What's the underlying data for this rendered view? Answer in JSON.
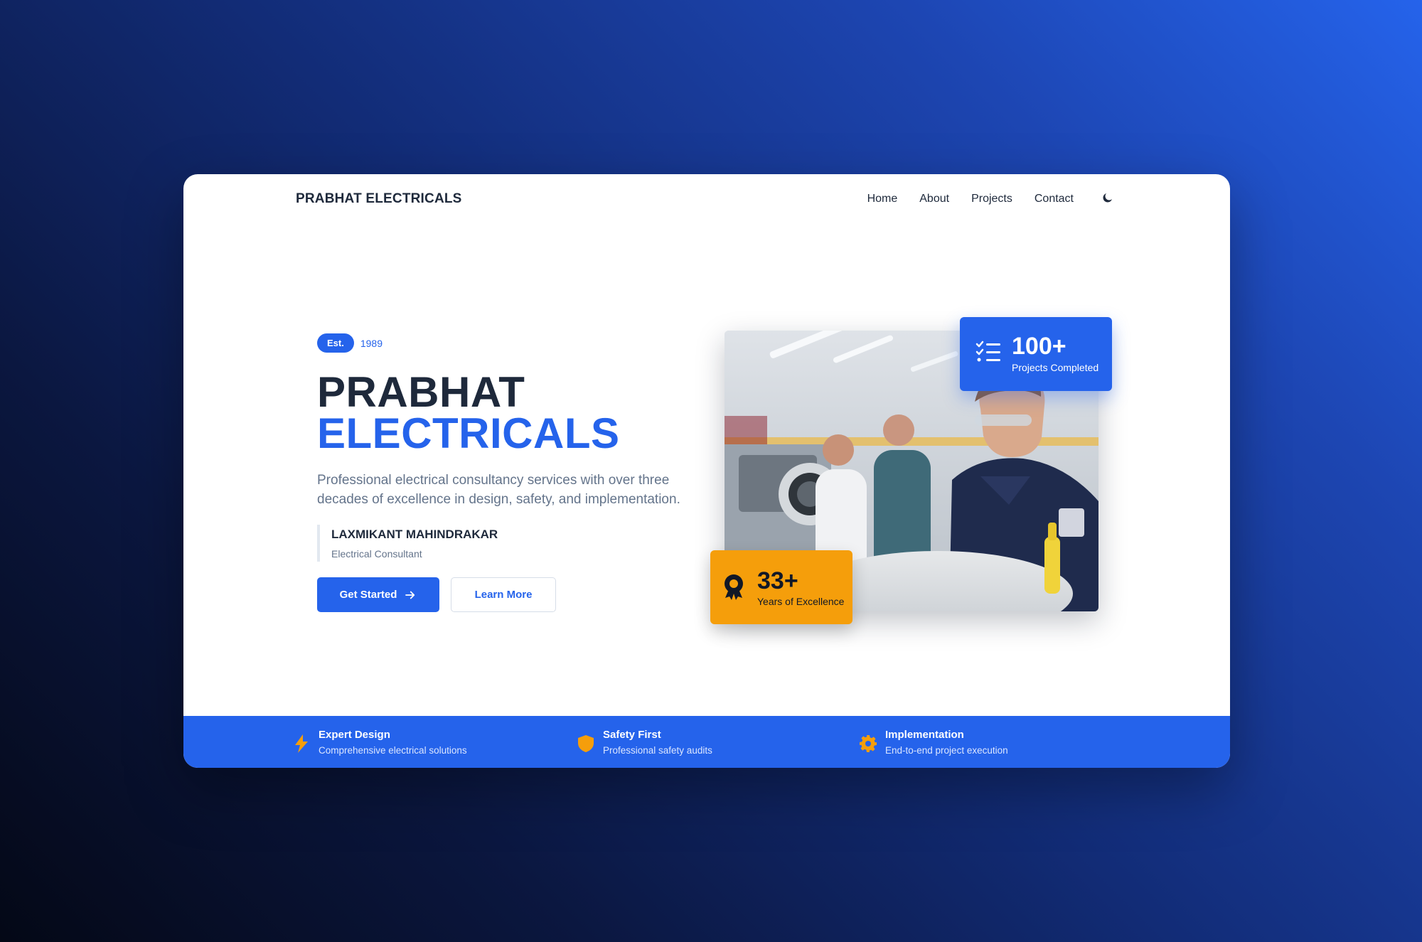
{
  "header": {
    "brand": "PRABHAT ELECTRICALS",
    "nav": [
      "Home",
      "About",
      "Projects",
      "Contact"
    ],
    "theme_icon": "moon-icon"
  },
  "hero": {
    "badge": "Est.",
    "year": "1989",
    "title_line1": "PRABHAT",
    "title_line2": "ELECTRICALS",
    "description": "Professional electrical consultancy services with over three decades of excellence in design, safety, and implementation.",
    "person_name": "LAXMIKANT MAHINDRAKAR",
    "person_role": "Electrical Consultant",
    "primary_button": "Get Started",
    "secondary_button": "Learn More",
    "image_description_icon": "engineers-workshop-photo"
  },
  "stats": {
    "projects_value": "100+",
    "projects_label": "Projects Completed",
    "projects_icon": "checklist-icon",
    "years_value": "33+",
    "years_label": "Years of Excellence",
    "years_icon": "award-icon"
  },
  "features": [
    {
      "title": "Expert Design",
      "desc": "Comprehensive electrical solutions",
      "icon": "lightning-icon"
    },
    {
      "title": "Safety First",
      "desc": "Professional safety audits",
      "icon": "shield-icon"
    },
    {
      "title": "Implementation",
      "desc": "End-to-end project execution",
      "icon": "gear-icon"
    }
  ],
  "colors": {
    "accent": "#2563eb",
    "highlight": "#f59e0b",
    "text_dark": "#1e293b",
    "text_muted": "#64748b"
  }
}
